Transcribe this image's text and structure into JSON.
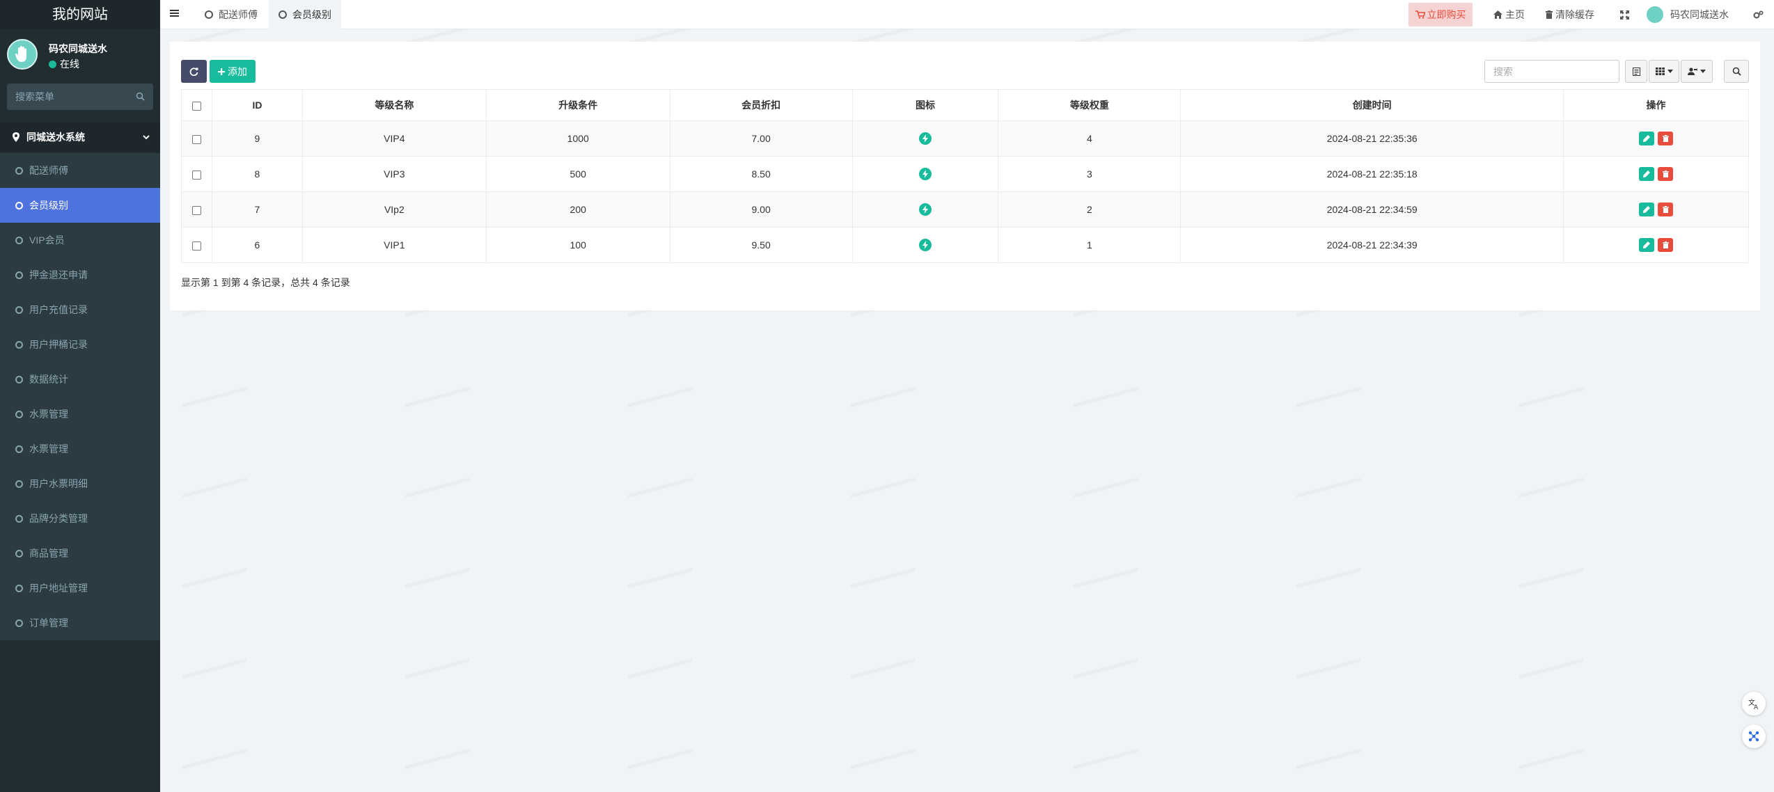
{
  "sidebar": {
    "logo": "我的网站",
    "user_name": "码农同城送水",
    "user_status": "在线",
    "search_placeholder": "搜索菜单",
    "group_label": "同城送水系统",
    "items": [
      {
        "label": "配送师傅",
        "active": false
      },
      {
        "label": "会员级别",
        "active": true
      },
      {
        "label": "VIP会员",
        "active": false
      },
      {
        "label": "押金退还申请",
        "active": false
      },
      {
        "label": "用户充值记录",
        "active": false
      },
      {
        "label": "用户押桶记录",
        "active": false
      },
      {
        "label": "数据统计",
        "active": false
      },
      {
        "label": "水票管理",
        "active": false
      },
      {
        "label": "水票管理",
        "active": false
      },
      {
        "label": "用户水票明细",
        "active": false
      },
      {
        "label": "品牌分类管理",
        "active": false
      },
      {
        "label": "商品管理",
        "active": false
      },
      {
        "label": "用户地址管理",
        "active": false
      },
      {
        "label": "订单管理",
        "active": false
      }
    ]
  },
  "topnav": {
    "tabs": [
      {
        "label": "配送师傅",
        "active": false
      },
      {
        "label": "会员级别",
        "active": true
      }
    ],
    "buy_label": "立即购买",
    "home_label": "主页",
    "clear_cache_label": "清除缓存",
    "user_label": "码农同城送水"
  },
  "toolbar": {
    "add_label": "添加",
    "search_placeholder": "搜索"
  },
  "table": {
    "headers": [
      "ID",
      "等级名称",
      "升级条件",
      "会员折扣",
      "图标",
      "等级权重",
      "创建时间",
      "操作"
    ],
    "rows": [
      {
        "id": "9",
        "name": "VIP4",
        "condition": "1000",
        "discount": "7.00",
        "weight": "4",
        "created": "2024-08-21 22:35:36"
      },
      {
        "id": "8",
        "name": "VIP3",
        "condition": "500",
        "discount": "8.50",
        "weight": "3",
        "created": "2024-08-21 22:35:18"
      },
      {
        "id": "7",
        "name": "VIp2",
        "condition": "200",
        "discount": "9.00",
        "weight": "2",
        "created": "2024-08-21 22:34:59"
      },
      {
        "id": "6",
        "name": "VIP1",
        "condition": "100",
        "discount": "9.50",
        "weight": "1",
        "created": "2024-08-21 22:34:39"
      }
    ]
  },
  "pagination": {
    "info": "显示第 1 到第 4 条记录，总共 4 条记录"
  },
  "colors": {
    "sidebar_bg": "#222d32",
    "active_menu": "#4e73df",
    "success": "#18bc9c",
    "danger": "#e74c3c"
  }
}
